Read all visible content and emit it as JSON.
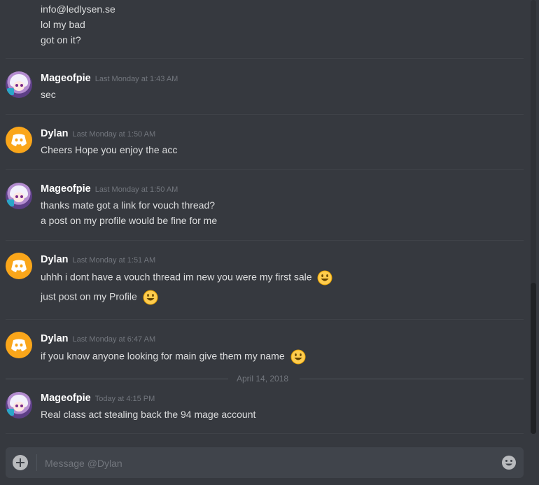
{
  "messages": {
    "top_lines": [
      "info@ledlysen.se",
      "lol my bad",
      "got on it?"
    ],
    "groups": [
      {
        "author": "Mageofpie",
        "avatar": "anime-avatar",
        "timestamp": "Last Monday at 1:43 AM",
        "lines": [
          "sec"
        ]
      },
      {
        "author": "Dylan",
        "avatar": "discord-logo-avatar",
        "timestamp": "Last Monday at 1:50 AM",
        "lines": [
          "Cheers Hope you enjoy the acc"
        ]
      },
      {
        "author": "Mageofpie",
        "avatar": "anime-avatar",
        "timestamp": "Last Monday at 1:50 AM",
        "lines": [
          "thanks mate got a link for vouch thread?",
          "a post on my profile would be fine for me"
        ]
      },
      {
        "author": "Dylan",
        "avatar": "discord-logo-avatar",
        "timestamp": "Last Monday at 1:51 AM",
        "lines": [
          "uhhh i dont have a vouch thread im new you were my first sale",
          "just post on my Profile"
        ]
      },
      {
        "author": "Dylan",
        "avatar": "discord-logo-avatar",
        "timestamp": "Last Monday at 6:47 AM",
        "lines": [
          "if you know anyone looking for main give them my name"
        ]
      },
      {
        "author": "Mageofpie",
        "avatar": "anime-avatar",
        "timestamp": "Today at 4:15 PM",
        "lines": [
          "Real class act stealing back the 94 mage account"
        ]
      }
    ]
  },
  "date_divider": "April 14, 2018",
  "composer": {
    "placeholder": "Message @Dylan"
  },
  "colors": {
    "background": "#36393f",
    "discord_orange": "#faa61a",
    "input_bg": "#40444b",
    "username": "#ffffff",
    "timestamp": "#72767d"
  },
  "icons": {
    "add": "plus-circle-icon",
    "emoji": "smiley-face-icon"
  }
}
